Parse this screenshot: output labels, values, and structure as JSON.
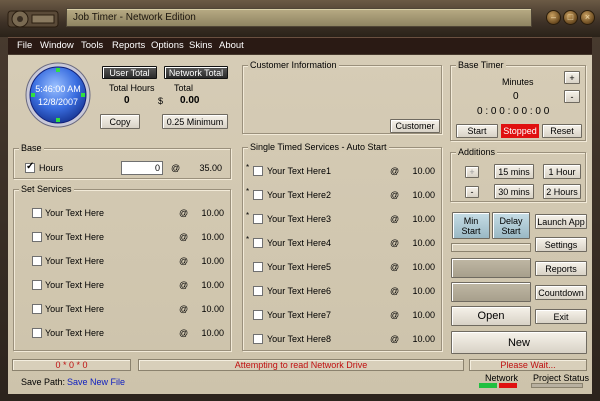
{
  "window": {
    "title": "Job Timer - Network Edition",
    "controls": {
      "minimize": "–",
      "maximize": "□",
      "close": "×"
    }
  },
  "menu": [
    "File",
    "Window",
    "Tools",
    "Reports",
    "Options",
    "Skins",
    "About"
  ],
  "clock": {
    "time": "5:46:00 AM",
    "date": "12/8/2007"
  },
  "totals": {
    "user_total_label": "User Total",
    "network_total_label": "Network Total",
    "total_hours_label": "Total Hours",
    "total_label": "Total",
    "hours_value": "0",
    "currency": "$",
    "amount_value": "0.00",
    "copy_label": "Copy",
    "minimum_label": "0.25 Minimum"
  },
  "customer": {
    "title": "Customer Information",
    "button": "Customer"
  },
  "base_timer": {
    "title": "Base Timer",
    "minutes_label": "Minutes",
    "minutes_value": "0",
    "plus": "+",
    "minus": "-",
    "display": "0 : 0 0 : 0 0 : 0 0",
    "start": "Start",
    "status": "Stopped",
    "reset": "Reset",
    "status_color": "#e01010"
  },
  "base": {
    "title": "Base",
    "hours_label": "Hours",
    "hours_checked": true,
    "input_value": "0",
    "at": "@",
    "rate": "35.00"
  },
  "set_services": {
    "title": "Set Services",
    "items": [
      {
        "label": "Your Text Here",
        "at": "@",
        "rate": "10.00"
      },
      {
        "label": "Your Text Here",
        "at": "@",
        "rate": "10.00"
      },
      {
        "label": "Your Text Here",
        "at": "@",
        "rate": "10.00"
      },
      {
        "label": "Your Text Here",
        "at": "@",
        "rate": "10.00"
      },
      {
        "label": "Your Text Here",
        "at": "@",
        "rate": "10.00"
      },
      {
        "label": "Your Text Here",
        "at": "@",
        "rate": "10.00"
      }
    ]
  },
  "single_timed": {
    "title": "Single Timed Services - Auto Start",
    "items": [
      {
        "star": "*",
        "label": "Your Text Here1",
        "at": "@",
        "rate": "10.00"
      },
      {
        "star": "*",
        "label": "Your Text Here2",
        "at": "@",
        "rate": "10.00"
      },
      {
        "star": "*",
        "label": "Your Text Here3",
        "at": "@",
        "rate": "10.00"
      },
      {
        "star": "*",
        "label": "Your Text Here4",
        "at": "@",
        "rate": "10.00"
      },
      {
        "star": "",
        "label": "Your Text Here5",
        "at": "@",
        "rate": "10.00"
      },
      {
        "star": "",
        "label": "Your Text Here6",
        "at": "@",
        "rate": "10.00"
      },
      {
        "star": "",
        "label": "Your Text Here7",
        "at": "@",
        "rate": "10.00"
      },
      {
        "star": "",
        "label": "Your Text Here8",
        "at": "@",
        "rate": "10.00"
      }
    ]
  },
  "additions": {
    "title": "Additions",
    "plus": "+",
    "minus": "-",
    "b15": "15 mins",
    "b1h": "1 Hour",
    "b30": "30 mins",
    "b2h": "2 Hours"
  },
  "side": {
    "min_start": [
      "Min",
      "Start"
    ],
    "delay_start": [
      "Delay",
      "Start"
    ],
    "launch_app": "Launch App",
    "settings": "Settings",
    "reports": "Reports",
    "countdown": "Countdown",
    "open": "Open",
    "exit": "Exit",
    "new": "New"
  },
  "status": {
    "counter": "0 * 0 * 0",
    "message": "Attempting to read Network Drive",
    "message_color": "#c01010",
    "wait": "Please Wait...",
    "save_path_label": "Save Path:",
    "save_path_value": "Save New File",
    "save_path_color": "#1020c0",
    "network_label": "Network",
    "project_status_label": "Project Status"
  }
}
